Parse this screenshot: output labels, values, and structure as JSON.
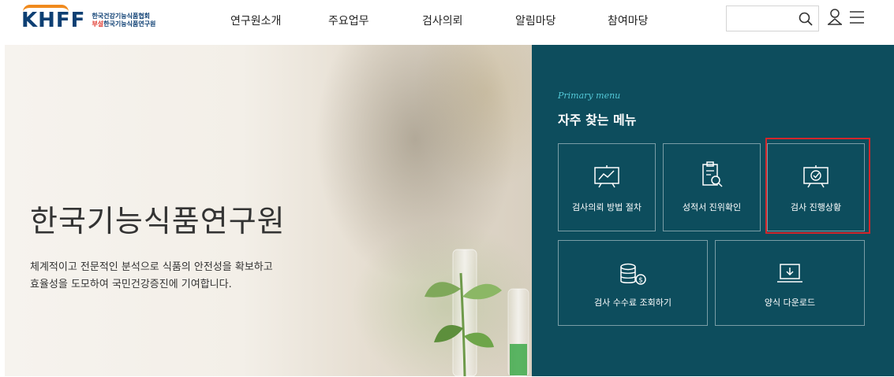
{
  "header": {
    "logo_mark": "KHFF",
    "logo_line1": "한국건강기능식품협회",
    "logo_tag": "부설",
    "logo_line2": "한국기능식품연구원",
    "nav": [
      "연구원소개",
      "주요업무",
      "검사의뢰",
      "알림마당",
      "참여마당"
    ],
    "search": {
      "value": "",
      "placeholder": ""
    },
    "icons": {
      "search": "search-icon",
      "user": "user-icon",
      "menu": "hamburger-menu-icon"
    }
  },
  "hero": {
    "title": "한국기능식품연구원",
    "desc_line1": "체계적이고 전문적인 분석으로 식품의 안전성을 확보하고",
    "desc_line2": "효율성을 도모하여 국민건강증진에 기여합니다."
  },
  "quick_menu": {
    "subtitle": "Primary menu",
    "title": "자주 찾는 메뉴",
    "items": [
      {
        "label": "검사의뢰 방법 절차",
        "icon": "chart-board-icon"
      },
      {
        "label": "성적서 진위확인",
        "icon": "document-search-icon"
      },
      {
        "label": "검사 진행상황",
        "icon": "check-board-icon",
        "highlighted": true
      },
      {
        "label": "검사 수수료 조회하기",
        "icon": "coins-icon"
      },
      {
        "label": "양식 다운로드",
        "icon": "laptop-download-icon"
      }
    ]
  },
  "colors": {
    "panel_bg": "#0d4d5d",
    "accent_cyan": "#53c7d6",
    "logo_navy": "#0d3f73",
    "logo_orange": "#f08a1d",
    "highlight_red": "#d3262b"
  }
}
